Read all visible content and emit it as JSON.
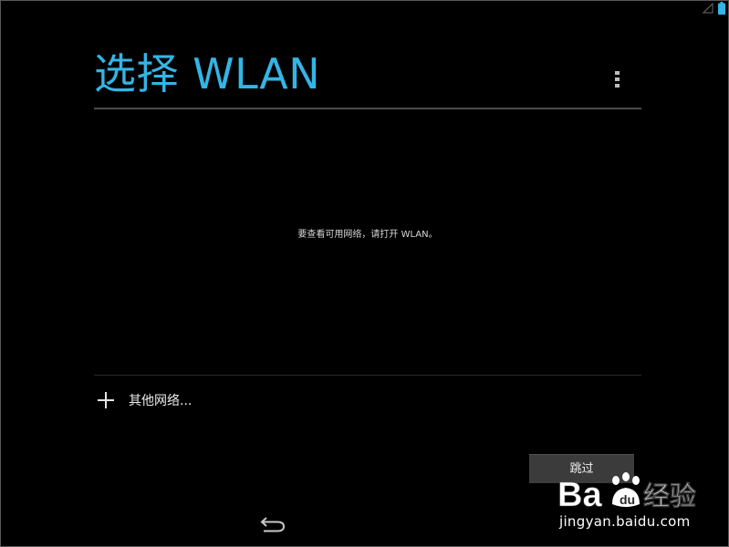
{
  "header": {
    "title": "选择 WLAN",
    "menu_icon": "overflow-menu-icon"
  },
  "main": {
    "empty_message": "要查看可用网络，请打开 WLAN。",
    "other_network": {
      "icon": "plus-icon",
      "label": "其他网络..."
    }
  },
  "footer": {
    "skip_label": "跳过",
    "back_icon": "back-arrow-icon"
  },
  "status_bar": {
    "icons": [
      "signal-icon",
      "battery-icon"
    ]
  },
  "watermark": {
    "brand_text": "Baidu经验",
    "url": "jingyan.baidu.com"
  },
  "colors": {
    "accent": "#33b5e5",
    "background": "#000000",
    "button": "#3b3b3b",
    "divider": "#4b4b4b"
  }
}
